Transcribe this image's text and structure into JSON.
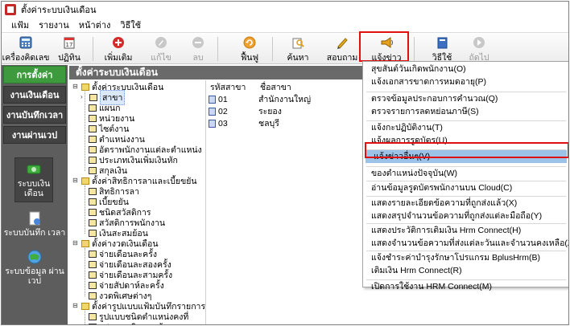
{
  "window": {
    "title": "ตั้งค่าระบบเงินเดือน"
  },
  "menubar": {
    "items": [
      "แฟ้ม",
      "รายงาน",
      "หน้าต่าง",
      "วิธีใช้"
    ]
  },
  "toolbar": {
    "buttons": [
      {
        "label": "เครื่องคิดเลข",
        "icon": "calculator-icon",
        "disabled": false
      },
      {
        "label": "ปฏิทิน",
        "icon": "calendar-icon",
        "disabled": false
      },
      {
        "label": "เพิ่มเติม",
        "icon": "add-icon",
        "disabled": false
      },
      {
        "label": "แก้ไข",
        "icon": "edit-icon",
        "disabled": true
      },
      {
        "label": "ลบ",
        "icon": "delete-icon",
        "disabled": true
      },
      {
        "label": "ฟื้นฟู",
        "icon": "refresh-icon",
        "disabled": false
      },
      {
        "label": "ค้นหา",
        "icon": "search-icon",
        "disabled": false
      },
      {
        "label": "สอบถาม",
        "icon": "inquiry-icon",
        "disabled": false
      },
      {
        "label": "แจ้งข่าว",
        "icon": "megaphone-icon",
        "disabled": false
      },
      {
        "label": "วิธีใช้",
        "icon": "help-icon",
        "disabled": false
      },
      {
        "label": "ถัดไป",
        "icon": "next-icon",
        "disabled": true
      }
    ]
  },
  "sidebar": {
    "tabs": [
      "การตั้งค่า",
      "งานเงินเดือน",
      "งานบันทึกเวลา",
      "งานผ่านเวป"
    ],
    "modules": [
      "ระบบเงิน เดือน",
      "ระบบบันทึก เวลา",
      "ระบบข้อมูล ผ่านเวป"
    ]
  },
  "panel": {
    "title": "ตั้งค่าระบบเงินเดือน"
  },
  "tree": {
    "items": [
      "ตั้งค่าระบบเงินเดือน",
      "สาขา",
      "แผนก",
      "หน่วยงาน",
      "ไซต์งาน",
      "ตำแหน่งงาน",
      "อัตราพนักงานแต่ละตำแหน่ง",
      "ประเภทเงินเพิ่มเงินหัก",
      "สกุลเงิน",
      "ตั้งค่าสิทธิการลาและเบี้ยขยัน",
      "สิทธิการลา",
      "เบี้ยขยัน",
      "ชนิดสวัสดิการ",
      "สวัสดิการพนักงาน",
      "เงินสะสมย้อน",
      "ตั้งค่างวดเงินเดือน",
      "จ่ายเดือนละครั้ง",
      "จ่ายเดือนละสองครั้ง",
      "จ่ายเดือนละสามครั้ง",
      "จ่ายสัปดาห์ละครั้ง",
      "งวดพิเศษต่างๆ",
      "ตั้งค่ารูปแบบแฟ้มบันทึกรายการสำห",
      "รูปแบบชนิดตำแหน่งคงที่",
      "รูปแบบชนิดแยกด้วยจุลภาค"
    ]
  },
  "grid": {
    "columns": [
      "รหัสสาขา",
      "ชื่อสาขา"
    ],
    "rows": [
      {
        "code": "01",
        "name": "สำนักงานใหญ่"
      },
      {
        "code": "02",
        "name": "ระยอง"
      },
      {
        "code": "03",
        "name": "ชลบุรี"
      }
    ]
  },
  "dropdown": {
    "items": [
      "สุขสันต์วันเกิดพนักงาน(O)",
      "แจ้งเอกสารขาดการหมดอายุ(P)",
      "ตรวจข้อมูลประกอบการคำนวณ(Q)",
      "ตรวจรายการลดหย่อนภาษี(S)",
      "แจ้งกะปฏิบัติงาน(T)",
      "แจ้งผลการรูดบัตร(U)",
      "แจ้งข่าวอื่นๆ(V)",
      "ของตำแหน่งปัจจุบัน(W)",
      "อ่านข้อมูลรูดบัตรพนักงานบน Cloud(C)",
      "แสดงรายละเอียดข้อความที่ถูกส่งแล้ว(X)",
      "แสดงสรุปจำนวนข้อความที่ถูกส่งแต่ละมือถือ(Y)",
      "แสดงประวัติการเติมเงิน Hrm Connect(H)",
      "แสดงจำนวนข้อความที่ส่งแต่ละวันและจำนวนคงเหลือ(Z)",
      "แจ้งชำระค่าบำรุงรักษาโปรแกรม BplusHrm(B)",
      "เติมเงิน Hrm Connect(R)",
      "เปิดการใช้งาน HRM Connect(M)"
    ],
    "highlighted": "แจ้งข่าวอื่นๆ(V)"
  },
  "colors": {
    "accent_green": "#3d9a3d",
    "highlight_red": "#e01010",
    "hover_blue": "#9cc2e8",
    "sidebar_gray": "#5d5d5d"
  }
}
